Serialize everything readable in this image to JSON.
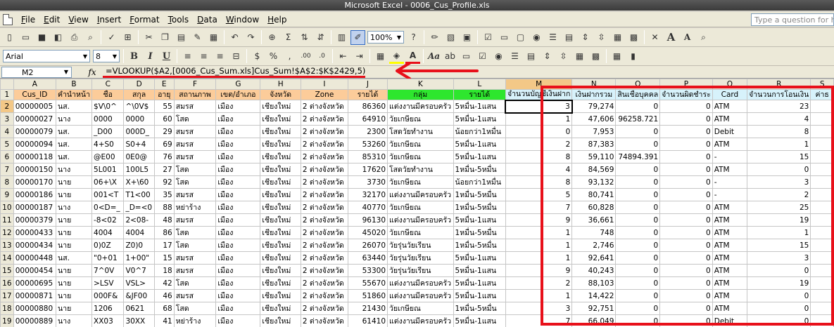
{
  "window": {
    "title": "Microsoft Excel - 0006_Cus_Profile.xls"
  },
  "menu": {
    "items": [
      "File",
      "Edit",
      "View",
      "Insert",
      "Format",
      "Tools",
      "Data",
      "Window",
      "Help"
    ],
    "ask_placeholder": "Type a question for help"
  },
  "toolbar": {
    "zoom": "100%",
    "font_name": "Arial",
    "font_size": "8"
  },
  "formula_bar": {
    "name_box": "M2",
    "fx": "fx",
    "formula": "=VLOOKUP($A2,[0006_Cus_Sum.xls]Cus_Sum!$A$2:$K$2429,5)"
  },
  "colors": {
    "highlight_red": "#e8101a",
    "header_orange": "#fccc9a",
    "header_green": "#2ee62e",
    "header_blue": "#d7f2fb"
  },
  "columns": [
    {
      "letter": "A",
      "header": "Cus_ID",
      "style": "orange"
    },
    {
      "letter": "B",
      "header": "คำนำหน้า",
      "style": "orange"
    },
    {
      "letter": "C",
      "header": "ชื่อ",
      "style": "orange"
    },
    {
      "letter": "D",
      "header": "สกุล",
      "style": "orange"
    },
    {
      "letter": "E",
      "header": "อายุ",
      "style": "orange"
    },
    {
      "letter": "F",
      "header": "สถานภาพ",
      "style": "orange"
    },
    {
      "letter": "G",
      "header": "เขต/อำเภอ",
      "style": "orange"
    },
    {
      "letter": "H",
      "header": "จังหวัด",
      "style": "orange"
    },
    {
      "letter": "I",
      "header": "Zone",
      "style": "orange"
    },
    {
      "letter": "J",
      "header": "รายได้",
      "style": "orange"
    },
    {
      "letter": "K",
      "header": "กลุ่ม",
      "style": "green"
    },
    {
      "letter": "L",
      "header": "รายได้",
      "style": "green"
    },
    {
      "letter": "M",
      "header": "จำนวนบัญชีเงินฝาก",
      "style": "blue"
    },
    {
      "letter": "N",
      "header": "เงินฝากรวม",
      "style": "blue"
    },
    {
      "letter": "O",
      "header": "สินเชื่อบุคคล",
      "style": "blue"
    },
    {
      "letter": "P",
      "header": "จำนวนผิดชำระ",
      "style": "blue"
    },
    {
      "letter": "Q",
      "header": "Card",
      "style": "blue"
    },
    {
      "letter": "R",
      "header": "จำนวนการโอนเงิน",
      "style": "blue"
    },
    {
      "letter": "S",
      "header": "ค่าธ",
      "style": "blue"
    }
  ],
  "rows": [
    {
      "n": "2",
      "cells": [
        "00000005",
        "นส.",
        "$V\\0^",
        "^\\0V$",
        "55",
        "สมรส",
        "เมือง",
        "เชียงใหม่",
        "2 ต่างจังหวัด",
        "86360",
        "แต่งงานมีครอบครัว",
        "5หมื่น-1แสน",
        "3",
        "79,274",
        "0",
        "0",
        "ATM",
        "23",
        ""
      ]
    },
    {
      "n": "3",
      "cells": [
        "00000027",
        "นาง",
        "0000",
        "0000",
        "60",
        "โสด",
        "เมือง",
        "เชียงใหม่",
        "2 ต่างจังหวัด",
        "64910",
        "วัยเกษียณ",
        "5หมื่น-1แสน",
        "1",
        "47,606",
        "96258.721",
        "0",
        "ATM",
        "4",
        ""
      ]
    },
    {
      "n": "4",
      "cells": [
        "00000079",
        "นส.",
        "_D00",
        "000D_",
        "29",
        "สมรส",
        "เมือง",
        "เชียงใหม่",
        "2 ต่างจังหวัด",
        "2300",
        "โสดวัยทำงาน",
        "น้อยกว่า1หมื่น",
        "0",
        "7,953",
        "0",
        "0",
        "Debit",
        "8",
        ""
      ]
    },
    {
      "n": "5",
      "cells": [
        "00000094",
        "นส.",
        "4+S0",
        "S0+4",
        "69",
        "สมรส",
        "เมือง",
        "เชียงใหม่",
        "2 ต่างจังหวัด",
        "53260",
        "วัยเกษียณ",
        "5หมื่น-1แสน",
        "2",
        "87,383",
        "0",
        "0",
        "ATM",
        "1",
        ""
      ]
    },
    {
      "n": "6",
      "cells": [
        "00000118",
        "นส.",
        "@E00",
        "0E0@",
        "76",
        "สมรส",
        "เมือง",
        "เชียงใหม่",
        "2 ต่างจังหวัด",
        "85310",
        "วัยเกษียณ",
        "5หมื่น-1แสน",
        "8",
        "59,110",
        "74894.391",
        "0",
        "-",
        "15",
        ""
      ]
    },
    {
      "n": "7",
      "cells": [
        "00000150",
        "นาง",
        "5L001",
        "100L5",
        "27",
        "โสด",
        "เมือง",
        "เชียงใหม่",
        "2 ต่างจังหวัด",
        "17620",
        "โสดวัยทำงาน",
        "1หมื่น-5หมื่น",
        "4",
        "84,569",
        "0",
        "0",
        "ATM",
        "0",
        ""
      ]
    },
    {
      "n": "8",
      "cells": [
        "00000170",
        "นาย",
        "06+\\X",
        "X+\\60",
        "92",
        "โสด",
        "เมือง",
        "เชียงใหม่",
        "2 ต่างจังหวัด",
        "3730",
        "วัยเกษียณ",
        "น้อยกว่า1หมื่น",
        "8",
        "93,132",
        "0",
        "0",
        "-",
        "3",
        ""
      ]
    },
    {
      "n": "9",
      "cells": [
        "00000186",
        "นาย",
        "001<T",
        "T1<00",
        "35",
        "สมรส",
        "เมือง",
        "เชียงใหม่",
        "2 ต่างจังหวัด",
        "32170",
        "แต่งงานมีครอบครัว",
        "1หมื่น-5หมื่น",
        "5",
        "80,741",
        "0",
        "0",
        "-",
        "2",
        ""
      ]
    },
    {
      "n": "10",
      "cells": [
        "00000187",
        "นาง",
        "0<D=_",
        "_D=<0",
        "88",
        "หย่าร้าง",
        "เมือง",
        "เชียงใหม่",
        "2 ต่างจังหวัด",
        "40770",
        "วัยเกษียณ",
        "1หมื่น-5หมื่น",
        "7",
        "60,828",
        "0",
        "0",
        "ATM",
        "25",
        ""
      ]
    },
    {
      "n": "11",
      "cells": [
        "00000379",
        "นาย",
        "-8<02",
        "2<08-",
        "48",
        "สมรส",
        "เมือง",
        "เชียงใหม่",
        "2 ต่างจังหวัด",
        "96130",
        "แต่งงานมีครอบครัว",
        "5หมื่น-1แสน",
        "9",
        "36,661",
        "0",
        "0",
        "ATM",
        "19",
        ""
      ]
    },
    {
      "n": "12",
      "cells": [
        "00000433",
        "นาย",
        "4004",
        "4004",
        "86",
        "โสด",
        "เมือง",
        "เชียงใหม่",
        "2 ต่างจังหวัด",
        "45020",
        "วัยเกษียณ",
        "1หมื่น-5หมื่น",
        "1",
        "748",
        "0",
        "0",
        "ATM",
        "1",
        ""
      ]
    },
    {
      "n": "13",
      "cells": [
        "00000434",
        "นาย",
        "0)0Z",
        "Z0)0",
        "17",
        "โสด",
        "เมือง",
        "เชียงใหม่",
        "2 ต่างจังหวัด",
        "26070",
        "วัยรุ่นวัยเรียน",
        "1หมื่น-5หมื่น",
        "1",
        "2,746",
        "0",
        "0",
        "ATM",
        "15",
        ""
      ]
    },
    {
      "n": "14",
      "cells": [
        "00000448",
        "นส.",
        "\"0+01",
        "1+00\"",
        "15",
        "สมรส",
        "เมือง",
        "เชียงใหม่",
        "2 ต่างจังหวัด",
        "63440",
        "วัยรุ่นวัยเรียน",
        "5หมื่น-1แสน",
        "1",
        "92,641",
        "0",
        "0",
        "ATM",
        "3",
        ""
      ]
    },
    {
      "n": "15",
      "cells": [
        "00000454",
        "นาย",
        "7^0V",
        "V0^7",
        "18",
        "สมรส",
        "เมือง",
        "เชียงใหม่",
        "2 ต่างจังหวัด",
        "53300",
        "วัยรุ่นวัยเรียน",
        "5หมื่น-1แสน",
        "9",
        "40,243",
        "0",
        "0",
        "ATM",
        "0",
        ""
      ]
    },
    {
      "n": "16",
      "cells": [
        "00000695",
        "นาย",
        ">LSV",
        "VSL>",
        "42",
        "โสด",
        "เมือง",
        "เชียงใหม่",
        "2 ต่างจังหวัด",
        "55670",
        "แต่งงานมีครอบครัว",
        "5หมื่น-1แสน",
        "2",
        "88,103",
        "0",
        "0",
        "ATM",
        "19",
        ""
      ]
    },
    {
      "n": "17",
      "cells": [
        "00000871",
        "นาย",
        "000F&",
        "&JF00",
        "46",
        "สมรส",
        "เมือง",
        "เชียงใหม่",
        "2 ต่างจังหวัด",
        "51860",
        "แต่งงานมีครอบครัว",
        "5หมื่น-1แสน",
        "1",
        "14,422",
        "0",
        "0",
        "ATM",
        "0",
        ""
      ]
    },
    {
      "n": "18",
      "cells": [
        "00000880",
        "นาย",
        "1206",
        "0621",
        "68",
        "โสด",
        "เมือง",
        "เชียงใหม่",
        "2 ต่างจังหวัด",
        "21430",
        "วัยเกษียณ",
        "1หมื่น-5หมื่น",
        "3",
        "92,751",
        "0",
        "0",
        "ATM",
        "0",
        ""
      ]
    },
    {
      "n": "19",
      "cells": [
        "00000889",
        "นาง",
        "XX03",
        "30XX",
        "41",
        "หย่าร้าง",
        "เมือง",
        "เชียงใหม่",
        "2 ต่างจังหวัด",
        "61410",
        "แต่งงานมีครอบครัว",
        "5หมื่น-1แสน",
        "7",
        "66,049",
        "0",
        "0",
        "Debit",
        "0",
        ""
      ]
    },
    {
      "n": "20",
      "cells": [
        "00000893",
        "นาย",
        "[0W0[",
        "0W0[0",
        "46",
        "สมรส",
        "เมือง",
        "เชียงใหม่",
        "2 ต่างจังหวัด",
        "29740",
        "แต่งงานมีครอบครัว",
        "1หมื่น-5หมื่น",
        "10",
        "40,888",
        "0",
        "0",
        "ATM",
        "7",
        ""
      ]
    }
  ]
}
